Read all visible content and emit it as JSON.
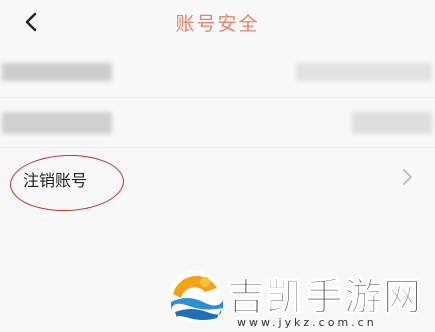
{
  "header": {
    "title": "账号安全",
    "back_icon": "chevron-left-icon"
  },
  "rows": [
    {
      "label": "",
      "value": ""
    },
    {
      "label": "",
      "value": ""
    },
    {
      "label": "注销账号",
      "icon": "chevron-right-icon"
    }
  ],
  "watermark": {
    "text": "吉凯手游网",
    "url": "www.jykz.com.cn"
  },
  "colors": {
    "title": "#e8836e",
    "annotation_circle": "#c0322b",
    "background": "#f8f8f8"
  }
}
